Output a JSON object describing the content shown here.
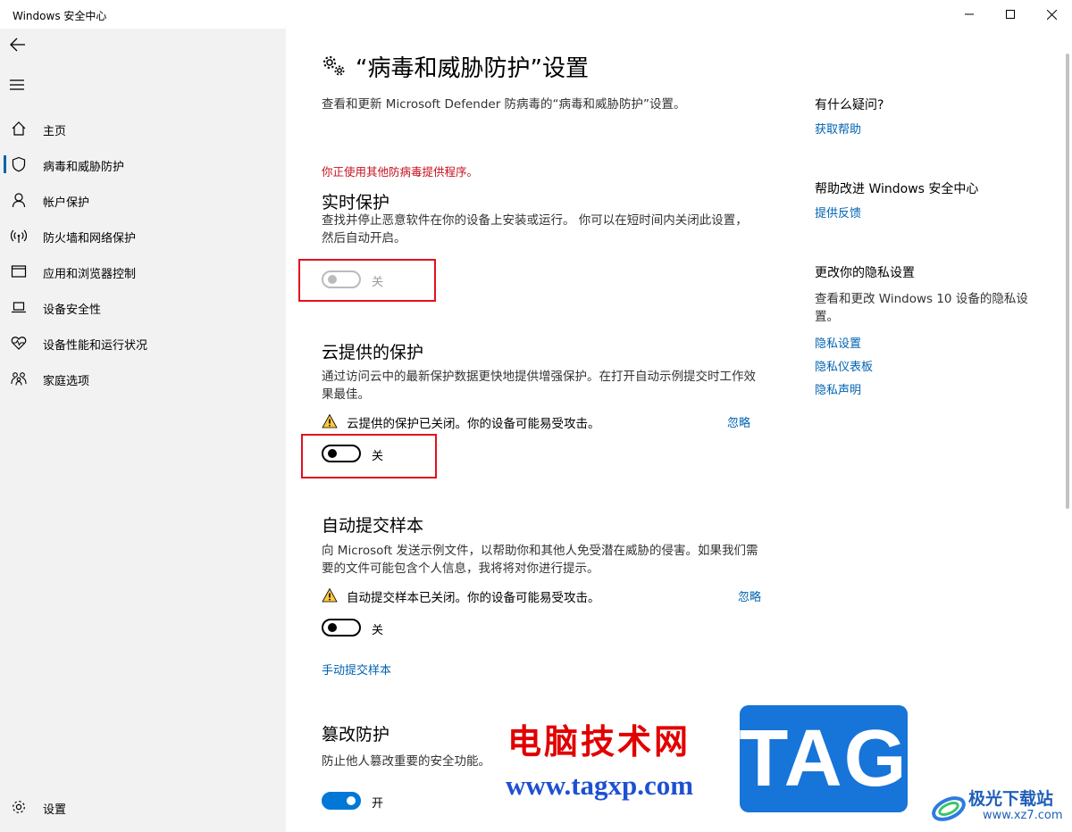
{
  "window": {
    "title": "Windows 安全中心",
    "controls": {
      "minimize": "—",
      "maximize": "☐",
      "close": "✕"
    }
  },
  "sidebar": {
    "items": [
      {
        "label": "主页",
        "icon": "home-icon"
      },
      {
        "label": "病毒和威胁防护",
        "icon": "shield-icon",
        "active": true
      },
      {
        "label": "帐户保护",
        "icon": "person-icon"
      },
      {
        "label": "防火墙和网络保护",
        "icon": "wifi-broadcast-icon"
      },
      {
        "label": "应用和浏览器控制",
        "icon": "app-window-icon"
      },
      {
        "label": "设备安全性",
        "icon": "laptop-icon"
      },
      {
        "label": "设备性能和运行状况",
        "icon": "heart-pulse-icon"
      },
      {
        "label": "家庭选项",
        "icon": "family-icon"
      }
    ],
    "settings_label": "设置"
  },
  "main": {
    "title": "“病毒和威胁防护”设置",
    "subtitle": "查看和更新 Microsoft Defender 防病毒的“病毒和威胁防护”设置。",
    "warning": "你正使用其他防病毒提供程序。",
    "realtime": {
      "title": "实时保护",
      "desc": "查找并停止恶意软件在你的设备上安装或运行。 你可以在短时间内关闭此设置，然后自动开启。",
      "toggle_label": "关",
      "state": "off",
      "enabled": false
    },
    "cloud": {
      "title": "云提供的保护",
      "desc": "通过访问云中的最新保护数据更快地提供增强保护。在打开自动示例提交时工作效果最佳。",
      "alert": "云提供的保护已关闭。你的设备可能易受攻击。",
      "dismiss": "忽略",
      "toggle_label": "关",
      "state": "off"
    },
    "sample": {
      "title": "自动提交样本",
      "desc": "向 Microsoft 发送示例文件，以帮助你和其他人免受潜在威胁的侵害。如果我们需要的文件可能包含个人信息，我将将对你进行提示。",
      "alert": "自动提交样本已关闭。你的设备可能易受攻击。",
      "dismiss": "忽略",
      "toggle_label": "关",
      "state": "off",
      "manual_link": "手动提交样本"
    },
    "tamper": {
      "title": "篡改防护",
      "desc": "防止他人篡改重要的安全功能。",
      "toggle_label": "开",
      "state": "on"
    }
  },
  "aside": {
    "help_title": "有什么疑问?",
    "help_link": "获取帮助",
    "improve_title": "帮助改进 Windows 安全中心",
    "feedback_link": "提供反馈",
    "privacy_title": "更改你的隐私设置",
    "privacy_text": "查看和更改 Windows 10 设备的隐私设置。",
    "privacy_links": [
      "隐私设置",
      "隐私仪表板",
      "隐私声明"
    ]
  },
  "watermark": {
    "brand": "电脑技术网",
    "url": "www.tagxp.com",
    "tag": "TAG",
    "site_name": "极光下载站",
    "site_domain": "www.xz7.com"
  },
  "colors": {
    "accent": "#0063b1",
    "toggle_on": "#0078d7",
    "warning_red": "#c50f1f",
    "highlight": "#e1111e",
    "sidebar_bg": "#f2f2f2"
  }
}
